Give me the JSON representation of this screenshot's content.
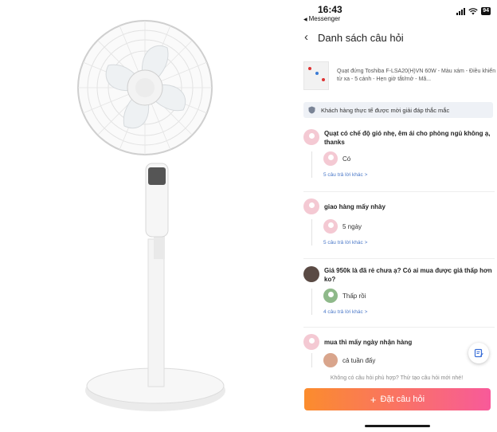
{
  "status_bar": {
    "time": "16:43",
    "back_app": "Messenger",
    "battery": "94"
  },
  "nav": {
    "title": "Danh sách câu hỏi"
  },
  "product": {
    "name": "Quạt đứng Toshiba F-LSA20(H)VN 60W - Màu xám - Điều khiển từ xa - 5 cánh - Hẹn giờ tắt/mở - Mã..."
  },
  "banner": {
    "text": "Khách hàng thực tế được mời giải đáp thắc mắc"
  },
  "questions": [
    {
      "question": "Quạt có chế độ gió nhẹ,  êm ái cho phòng ngủ không ạ,  thanks",
      "answer": "Có",
      "more": "5 câu trả lời khác >"
    },
    {
      "question": "giao hàng mấy nhày",
      "answer": "5 ngày",
      "more": "5 câu trả lời khác >"
    },
    {
      "question": "Giá 950k là đã rẻ chưa ạ? Có ai mua được giá thấp hơn ko?",
      "answer": "Thấp rồi",
      "more": "4 câu trả lời khác >"
    },
    {
      "question": "mua thì mấy ngày nhận hàng",
      "answer": "cả tuần đấy",
      "more": ""
    }
  ],
  "footer": {
    "hint": "Không có câu hỏi phù hợp? Thử tạo câu hỏi mới nhé!",
    "ask_button": "Đặt câu hỏi"
  },
  "icons": {
    "back": "chevron-left-icon",
    "shield": "shield-icon",
    "edit": "edit-icon",
    "plus": "plus-icon"
  },
  "colors": {
    "accent_start": "#fb8c2d",
    "accent_end": "#f85a9a",
    "link": "#4a78c8",
    "banner_bg": "#eef1f6"
  }
}
